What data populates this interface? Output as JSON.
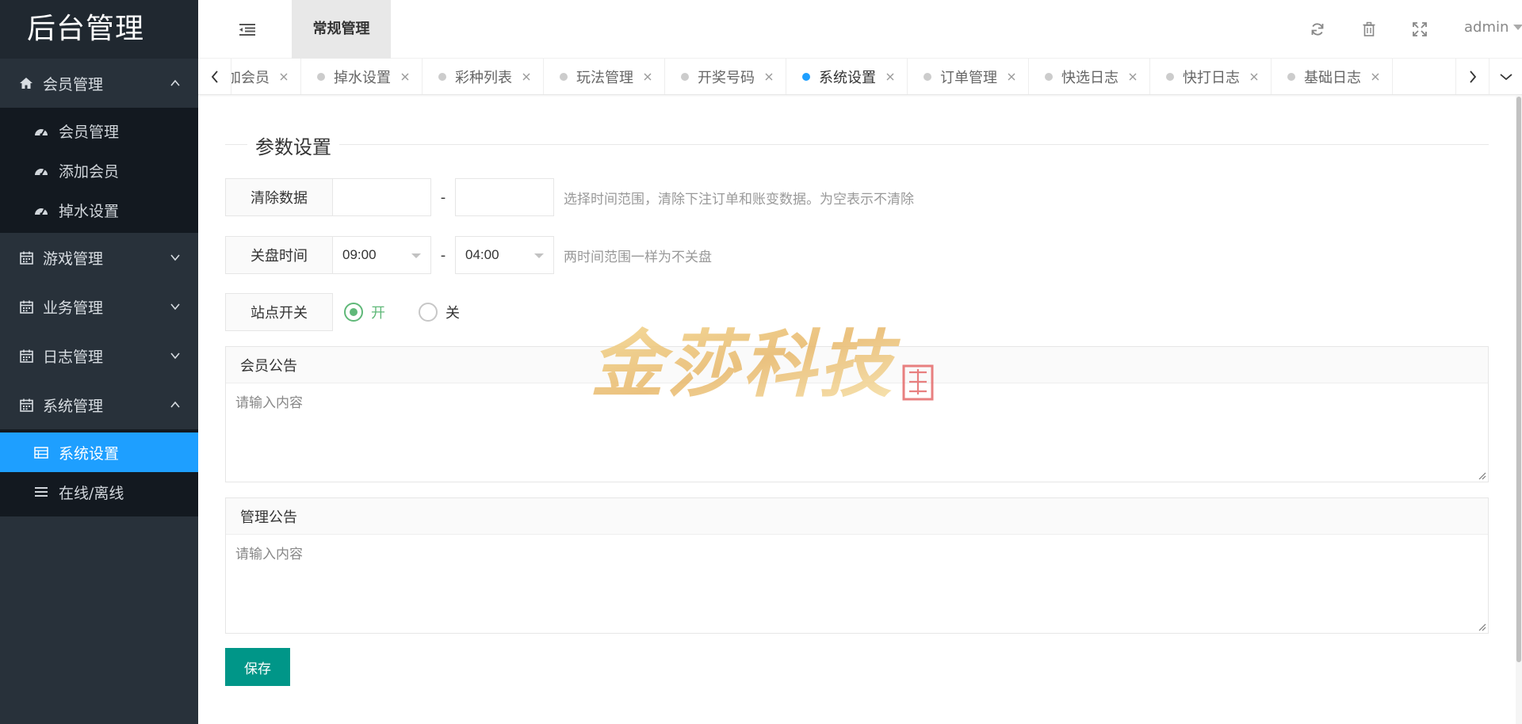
{
  "app": {
    "logo": "后台管理"
  },
  "header": {
    "top_tab": "常规管理",
    "user": "admin",
    "icons": [
      "refresh-icon",
      "trash-icon",
      "fullscreen-icon"
    ]
  },
  "sidebar": {
    "groups": [
      {
        "label": "会员管理",
        "icon": "home-icon",
        "expanded": true,
        "items": [
          {
            "label": "会员管理",
            "icon": "dashboard-icon"
          },
          {
            "label": "添加会员",
            "icon": "dashboard-icon"
          },
          {
            "label": "掉水设置",
            "icon": "dashboard-icon"
          }
        ]
      },
      {
        "label": "游戏管理",
        "icon": "calendar-icon",
        "expanded": false
      },
      {
        "label": "业务管理",
        "icon": "calendar-icon",
        "expanded": false
      },
      {
        "label": "日志管理",
        "icon": "calendar-icon",
        "expanded": false
      },
      {
        "label": "系统管理",
        "icon": "calendar-icon",
        "expanded": true,
        "items": [
          {
            "label": "系统设置",
            "icon": "list-icon",
            "active": true
          },
          {
            "label": "在线/离线",
            "icon": "menu-icon"
          }
        ]
      }
    ]
  },
  "tabs": [
    {
      "label": "加会员"
    },
    {
      "label": "掉水设置"
    },
    {
      "label": "彩种列表"
    },
    {
      "label": "玩法管理"
    },
    {
      "label": "开奖号码"
    },
    {
      "label": "系统设置",
      "active": true
    },
    {
      "label": "订单管理"
    },
    {
      "label": "快选日志"
    },
    {
      "label": "快打日志"
    },
    {
      "label": "基础日志"
    }
  ],
  "form": {
    "section_title": "参数设置",
    "clear_data": {
      "label": "清除数据",
      "start": "",
      "end": "",
      "separator": "-",
      "hint": "选择时间范围，清除下注订单和账变数据。为空表示不清除"
    },
    "close_time": {
      "label": "关盘时间",
      "start": "09:00",
      "end": "04:00",
      "separator": "-",
      "hint": "两时间范围一样为不关盘"
    },
    "site_switch": {
      "label": "站点开关",
      "on_label": "开",
      "off_label": "关",
      "value": "on"
    },
    "member_notice": {
      "label": "会员公告",
      "placeholder": "请输入内容",
      "value": ""
    },
    "admin_notice": {
      "label": "管理公告",
      "placeholder": "请输入内容",
      "value": ""
    },
    "save_label": "保存"
  },
  "watermark": {
    "text": "金莎科技"
  },
  "colors": {
    "sidebar_bg": "#28313a",
    "active_blue": "#1e9fff",
    "radio_green": "#5fb878",
    "save_btn": "#009688"
  }
}
